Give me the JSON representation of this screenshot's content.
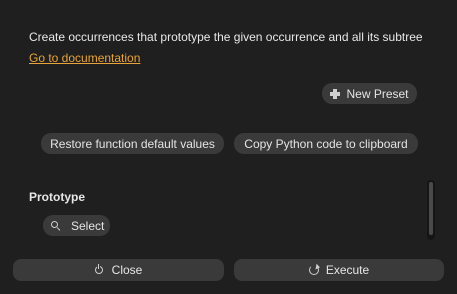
{
  "description": "Create occurrences that prototype the given occurrence and all its subtree",
  "documentation_link": "Go to documentation",
  "presets": {
    "new_preset_label": "New Preset",
    "new_preset_icon": "plus-icon"
  },
  "actions": {
    "restore_label": "Restore function default values",
    "copy_label": "Copy Python code to clipboard"
  },
  "parameters": {
    "prototype_title": "Prototype",
    "select_label": "Select",
    "select_icon": "search-icon"
  },
  "footer": {
    "close_label": "Close",
    "close_icon": "power-icon",
    "execute_label": "Execute",
    "execute_icon": "refresh-icon"
  },
  "colors": {
    "background": "#1f1f1f",
    "button": "#3a3a3a",
    "link": "#e8a33a",
    "text": "#e6e6e6"
  }
}
